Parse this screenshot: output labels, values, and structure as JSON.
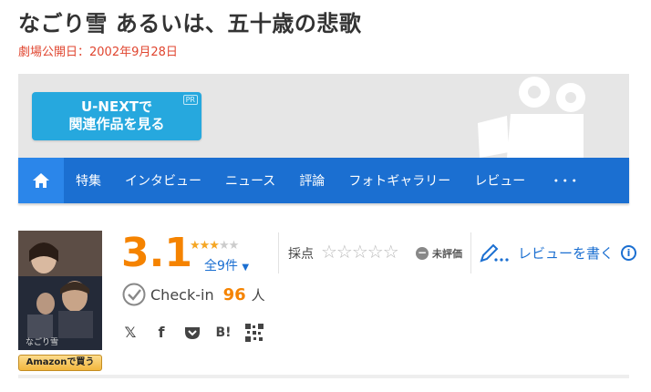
{
  "page": {
    "title": "なごり雪 あるいは、五十歳の悲歌",
    "release": "劇場公開日：2002年9月28日"
  },
  "banner": {
    "unext_line1": "U-NEXTで",
    "unext_line2": "関連作品を見る",
    "pr": "PR"
  },
  "nav": {
    "home_icon": "home-icon",
    "items": [
      "特集",
      "インタビュー",
      "ニュース",
      "評論",
      "フォトギャラリー",
      "レビュー",
      "･･･"
    ]
  },
  "movie": {
    "score": "3.1",
    "stars": 3,
    "review_count": "全9件",
    "checkin_label": "Check-in",
    "checkin_count": "96",
    "checkin_unit": "人",
    "amazon": "Amazonで買う"
  },
  "rating": {
    "label": "採点",
    "stars": "☆☆☆☆☆",
    "unrated": "未評価"
  },
  "review": {
    "label": "レビューを書く",
    "info": "i"
  },
  "share": {
    "x": "𝕏",
    "facebook": "f",
    "pocket": "pocket-icon",
    "hatena": "B!",
    "qr": "qr-icon"
  },
  "colors": {
    "accent": "#1b6fd1",
    "score": "#f58300",
    "release": "#e0452f",
    "unext": "#26a8de"
  }
}
